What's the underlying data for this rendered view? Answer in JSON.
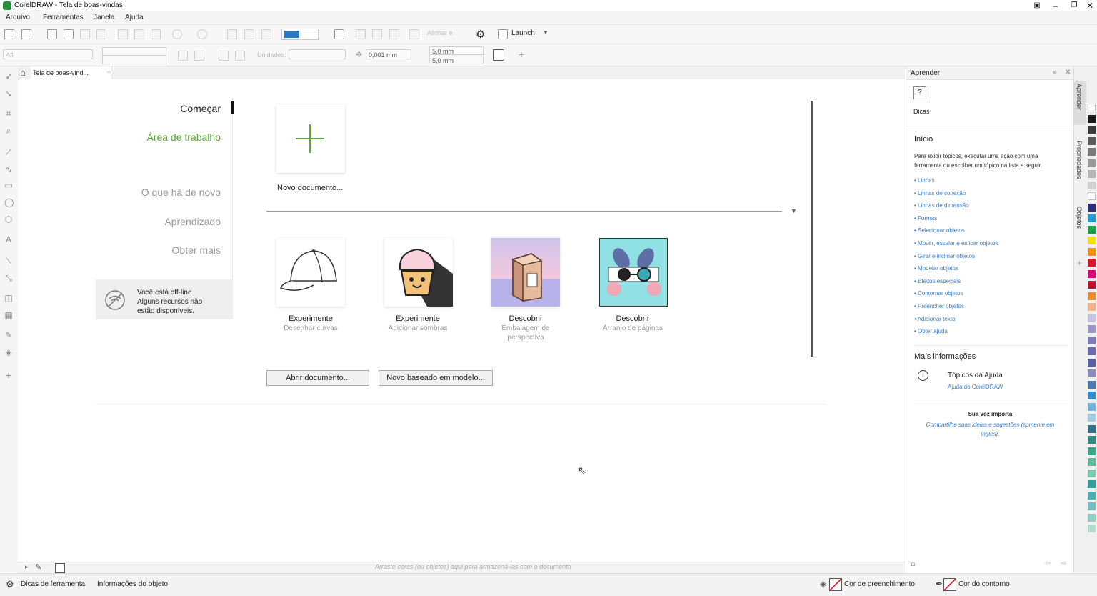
{
  "window": {
    "title": "CorelDRAW - Tela de boas-vindas"
  },
  "menu": [
    "Arquivo",
    "Ferramentas",
    "Janela",
    "Ajuda"
  ],
  "toolbar": {
    "align_label": "Alinhar e",
    "launch_label": "Launch",
    "page_size": "A4",
    "units_label": "Unidades:",
    "nudge": "0,001 mm",
    "dup_x": "5,0 mm",
    "dup_y": "5,0 mm"
  },
  "doc_tab": {
    "label": "Tela de boas-vind..."
  },
  "welcome": {
    "nav": {
      "start": "Começar",
      "workspace": "Área de trabalho",
      "whats_new": "O que há de novo",
      "learning": "Aprendizado",
      "get_more": "Obter mais"
    },
    "offline_text": [
      "Você está off-line.",
      "Alguns recursos não",
      "estão disponíveis."
    ],
    "new_doc_label": "Novo documento...",
    "tiles": [
      {
        "label": "Experimente",
        "sub": "Desenhar curvas"
      },
      {
        "label": "Experimente",
        "sub": "Adicionar sombras"
      },
      {
        "label": "Descobrir",
        "sub": "Embalagem de perspectiva"
      },
      {
        "label": "Descobrir",
        "sub": "Arranjo de páginas"
      }
    ],
    "open_button": "Abrir documento...",
    "template_button": "Novo baseado em modelo..."
  },
  "learn_panel": {
    "title": "Aprender",
    "tips_label": "Dicas",
    "start_heading": "Início",
    "intro": "Para exibir tópicos, executar uma ação com uma ferramenta ou escolher um tópico na lista a seguir.",
    "topics": [
      "Linhas",
      "Linhas de conexão",
      "Linhas de dimensão",
      "Formas",
      "Selecionar objetos",
      "Mover, escalar e esticar objetos",
      "Girar e inclinar objetos",
      "Modelar objetos",
      "Efeitos especiais",
      "Contornar objetos",
      "Preencher objetos",
      "Adicionar texto",
      "Obter ajuda"
    ],
    "more_heading": "Mais informações",
    "help_topics": "Tópicos da Ajuda",
    "help_link": "Ajuda do CorelDRAW",
    "voice_title": "Sua voz importa",
    "voice_text": "Compartilhe suas ideias e sugestões (somente em inglês)."
  },
  "dock_tabs": [
    "Aprender",
    "Propriedades",
    "Objetos"
  ],
  "doc_palette_hint": "Arraste cores (ou objetos) aqui para armazená-las com o documento",
  "status": {
    "tool_tips": "Dicas de ferramenta",
    "object_info": "Informações do objeto",
    "fill_color": "Cor de preenchimento",
    "outline_color": "Cor do contorno"
  },
  "colors": {
    "accent_green": "#2f9a3a",
    "link_blue": "#3b7fc4",
    "palette": [
      "#ffffff",
      "#1a1a1a",
      "#3a3a3a",
      "#5a5a5a",
      "#7a7a7a",
      "#9a9a9a",
      "#b5b5b5",
      "#d0d0d0",
      "#ffffff",
      "#2b2f80",
      "#1e9ad6",
      "#1aa34a",
      "#f5e400",
      "#f29100",
      "#e5142b",
      "#e0007a",
      "#c8102e",
      "#f08a24",
      "#f4b183",
      "#c5c1e0",
      "#9a95cc",
      "#7f7bbf",
      "#6b6cb0",
      "#5a5ea8",
      "#8a8cc0",
      "#4a78b5",
      "#2b8fd0",
      "#6fb3e0",
      "#9fcde8",
      "#2f6f8f",
      "#2a8f7a",
      "#3aa58a",
      "#5db89c",
      "#7fc8b0",
      "#2e9f9a",
      "#48b0b0",
      "#6cc0c0",
      "#90d0c8",
      "#b0dcd0"
    ]
  }
}
